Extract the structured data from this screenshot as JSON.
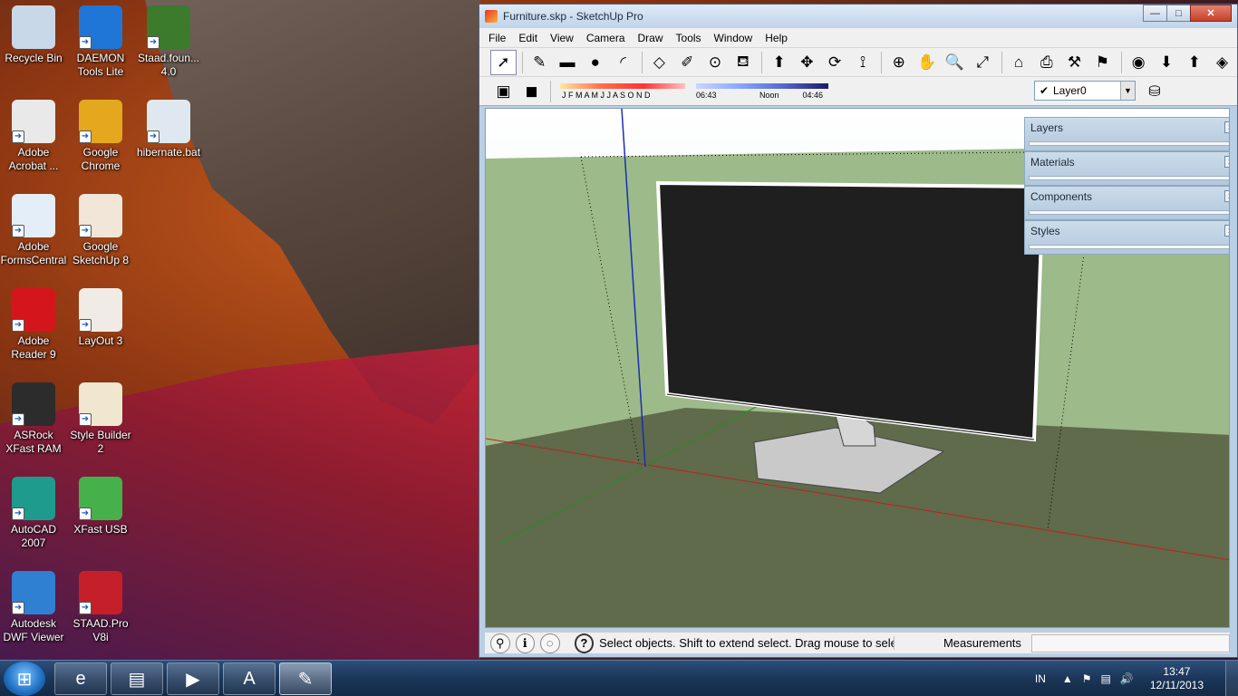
{
  "desktop": {
    "icons": [
      {
        "label": "Recycle Bin",
        "icon": "recycle-bin-icon",
        "color": "#c8d8e8"
      },
      {
        "label": "DAEMON Tools Lite",
        "icon": "daemon-tools-icon",
        "color": "#1f76d6"
      },
      {
        "label": "Staad.foun... 4.0",
        "icon": "staad-foundation-icon",
        "color": "#3c7a2c"
      },
      {
        "label": "Adobe Acrobat ...",
        "icon": "adobe-acrobat-icon",
        "color": "#e9e9e9"
      },
      {
        "label": "Google Chrome",
        "icon": "google-chrome-icon",
        "color": "#e3a81d"
      },
      {
        "label": "hibernate.bat",
        "icon": "gear-file-icon",
        "color": "#dfe8f0"
      },
      {
        "label": "Adobe FormsCentral",
        "icon": "forms-central-icon",
        "color": "#e4eef8"
      },
      {
        "label": "Google SketchUp 8",
        "icon": "sketchup-icon",
        "color": "#f2e6d8"
      },
      {
        "label": "Adobe Reader 9",
        "icon": "adobe-reader-icon",
        "color": "#d4161c"
      },
      {
        "label": "LayOut 3",
        "icon": "layout-icon",
        "color": "#f0ebe4"
      },
      {
        "label": "ASRock XFast RAM",
        "icon": "asrock-icon",
        "color": "#2c2c2c"
      },
      {
        "label": "Style Builder 2",
        "icon": "style-builder-icon",
        "color": "#f1e6d0"
      },
      {
        "label": "AutoCAD 2007",
        "icon": "autocad-icon",
        "color": "#1e9b8d"
      },
      {
        "label": "XFast USB",
        "icon": "xfast-usb-icon",
        "color": "#46b04a"
      },
      {
        "label": "Autodesk DWF Viewer",
        "icon": "dwf-viewer-icon",
        "color": "#2f7fd2"
      },
      {
        "label": "STAAD.Pro V8i",
        "icon": "staad-pro-icon",
        "color": "#c51f2a"
      }
    ]
  },
  "window": {
    "title": "Furniture.skp - SketchUp Pro",
    "controls": {
      "minimize": "—",
      "maximize": "□",
      "close": "✕"
    }
  },
  "menu": [
    "File",
    "Edit",
    "View",
    "Camera",
    "Draw",
    "Tools",
    "Window",
    "Help"
  ],
  "toolbar1": [
    {
      "icon": "select-arrow-icon",
      "glyph": "➚"
    },
    {
      "icon": "pencil-icon",
      "glyph": "✎"
    },
    {
      "icon": "rectangle-icon",
      "glyph": "▬"
    },
    {
      "icon": "circle-icon",
      "glyph": "●"
    },
    {
      "icon": "arc-icon",
      "glyph": "◜"
    },
    {
      "icon": "make-component-icon",
      "glyph": "◇"
    },
    {
      "icon": "eraser-icon",
      "glyph": "✐"
    },
    {
      "icon": "tape-measure-icon",
      "glyph": "⊙"
    },
    {
      "icon": "paint-bucket-icon",
      "glyph": "⛾"
    },
    {
      "icon": "push-pull-icon",
      "glyph": "⬆"
    },
    {
      "icon": "move-icon",
      "glyph": "✥"
    },
    {
      "icon": "rotate-icon",
      "glyph": "⟳"
    },
    {
      "icon": "follow-me-icon",
      "glyph": "⟟"
    },
    {
      "icon": "orbit-icon",
      "glyph": "⊕"
    },
    {
      "icon": "pan-icon",
      "glyph": "✋"
    },
    {
      "icon": "zoom-icon",
      "glyph": "🔍"
    },
    {
      "icon": "zoom-extents-icon",
      "glyph": "⤢"
    },
    {
      "icon": "warehouse-icon",
      "glyph": "⌂"
    },
    {
      "icon": "share-model-icon",
      "glyph": "⎙"
    },
    {
      "icon": "component-warehouse-icon",
      "glyph": "⚒"
    },
    {
      "icon": "place-model-icon",
      "glyph": "⚑"
    },
    {
      "icon": "google-earth-icon",
      "glyph": "◉"
    },
    {
      "icon": "get-models-icon",
      "glyph": "⬇"
    },
    {
      "icon": "share-component-icon",
      "glyph": "⬆"
    },
    {
      "icon": "extension-icon",
      "glyph": "◈"
    }
  ],
  "shadows": {
    "months": "J F M A M J J A S O N D",
    "time_start": "06:43",
    "time_noon": "Noon",
    "time_end": "04:46"
  },
  "layers": {
    "current": "Layer0"
  },
  "trays": [
    "Layers",
    "Materials",
    "Components",
    "Styles"
  ],
  "status": {
    "message": "Select objects. Shift to extend select. Drag mouse to sele",
    "measurements_label": "Measurements",
    "measurements_value": ""
  },
  "taskbar": {
    "items": [
      {
        "icon": "internet-explorer-icon",
        "glyph": "e"
      },
      {
        "icon": "file-explorer-icon",
        "glyph": "▤"
      },
      {
        "icon": "media-player-icon",
        "glyph": "▶"
      },
      {
        "icon": "autocad-taskbar-icon",
        "glyph": "A"
      },
      {
        "icon": "sketchup-taskbar-icon",
        "glyph": "✎"
      }
    ],
    "language": "IN",
    "time": "13:47",
    "date": "12/11/2013"
  }
}
